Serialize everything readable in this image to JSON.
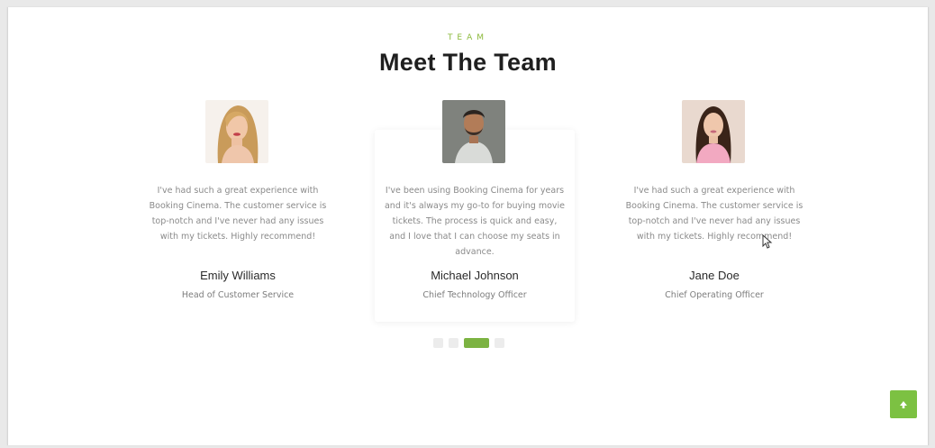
{
  "section": {
    "eyebrow": "TEAM",
    "title": "Meet The Team"
  },
  "team": [
    {
      "quote": "I've had such a great experience with Booking Cinema. The customer service is top-notch and I've never had any issues with my tickets. Highly recommend!",
      "name": "Emily Williams",
      "role": "Head of Customer Service",
      "avatar": "woman-blonde-avatar"
    },
    {
      "quote": "I've been using Booking Cinema for years and it's always my go-to for buying movie tickets. The process is quick and easy, and I love that I can choose my seats in advance.",
      "name": "Michael Johnson",
      "role": "Chief Technology Officer",
      "avatar": "man-beard-avatar"
    },
    {
      "quote": "I've had such a great experience with Booking Cinema. The customer service is top-notch and I've never had any issues with my tickets. Highly recommend!",
      "name": "Jane Doe",
      "role": "Chief Operating Officer",
      "avatar": "woman-dark-hair-avatar"
    }
  ],
  "carousel": {
    "active_index": 2,
    "dot_count": 4
  },
  "colors": {
    "accent": "#7cb342",
    "scroll_button": "#7cc142"
  },
  "icons": {
    "scroll_top": "arrow-up-icon"
  }
}
